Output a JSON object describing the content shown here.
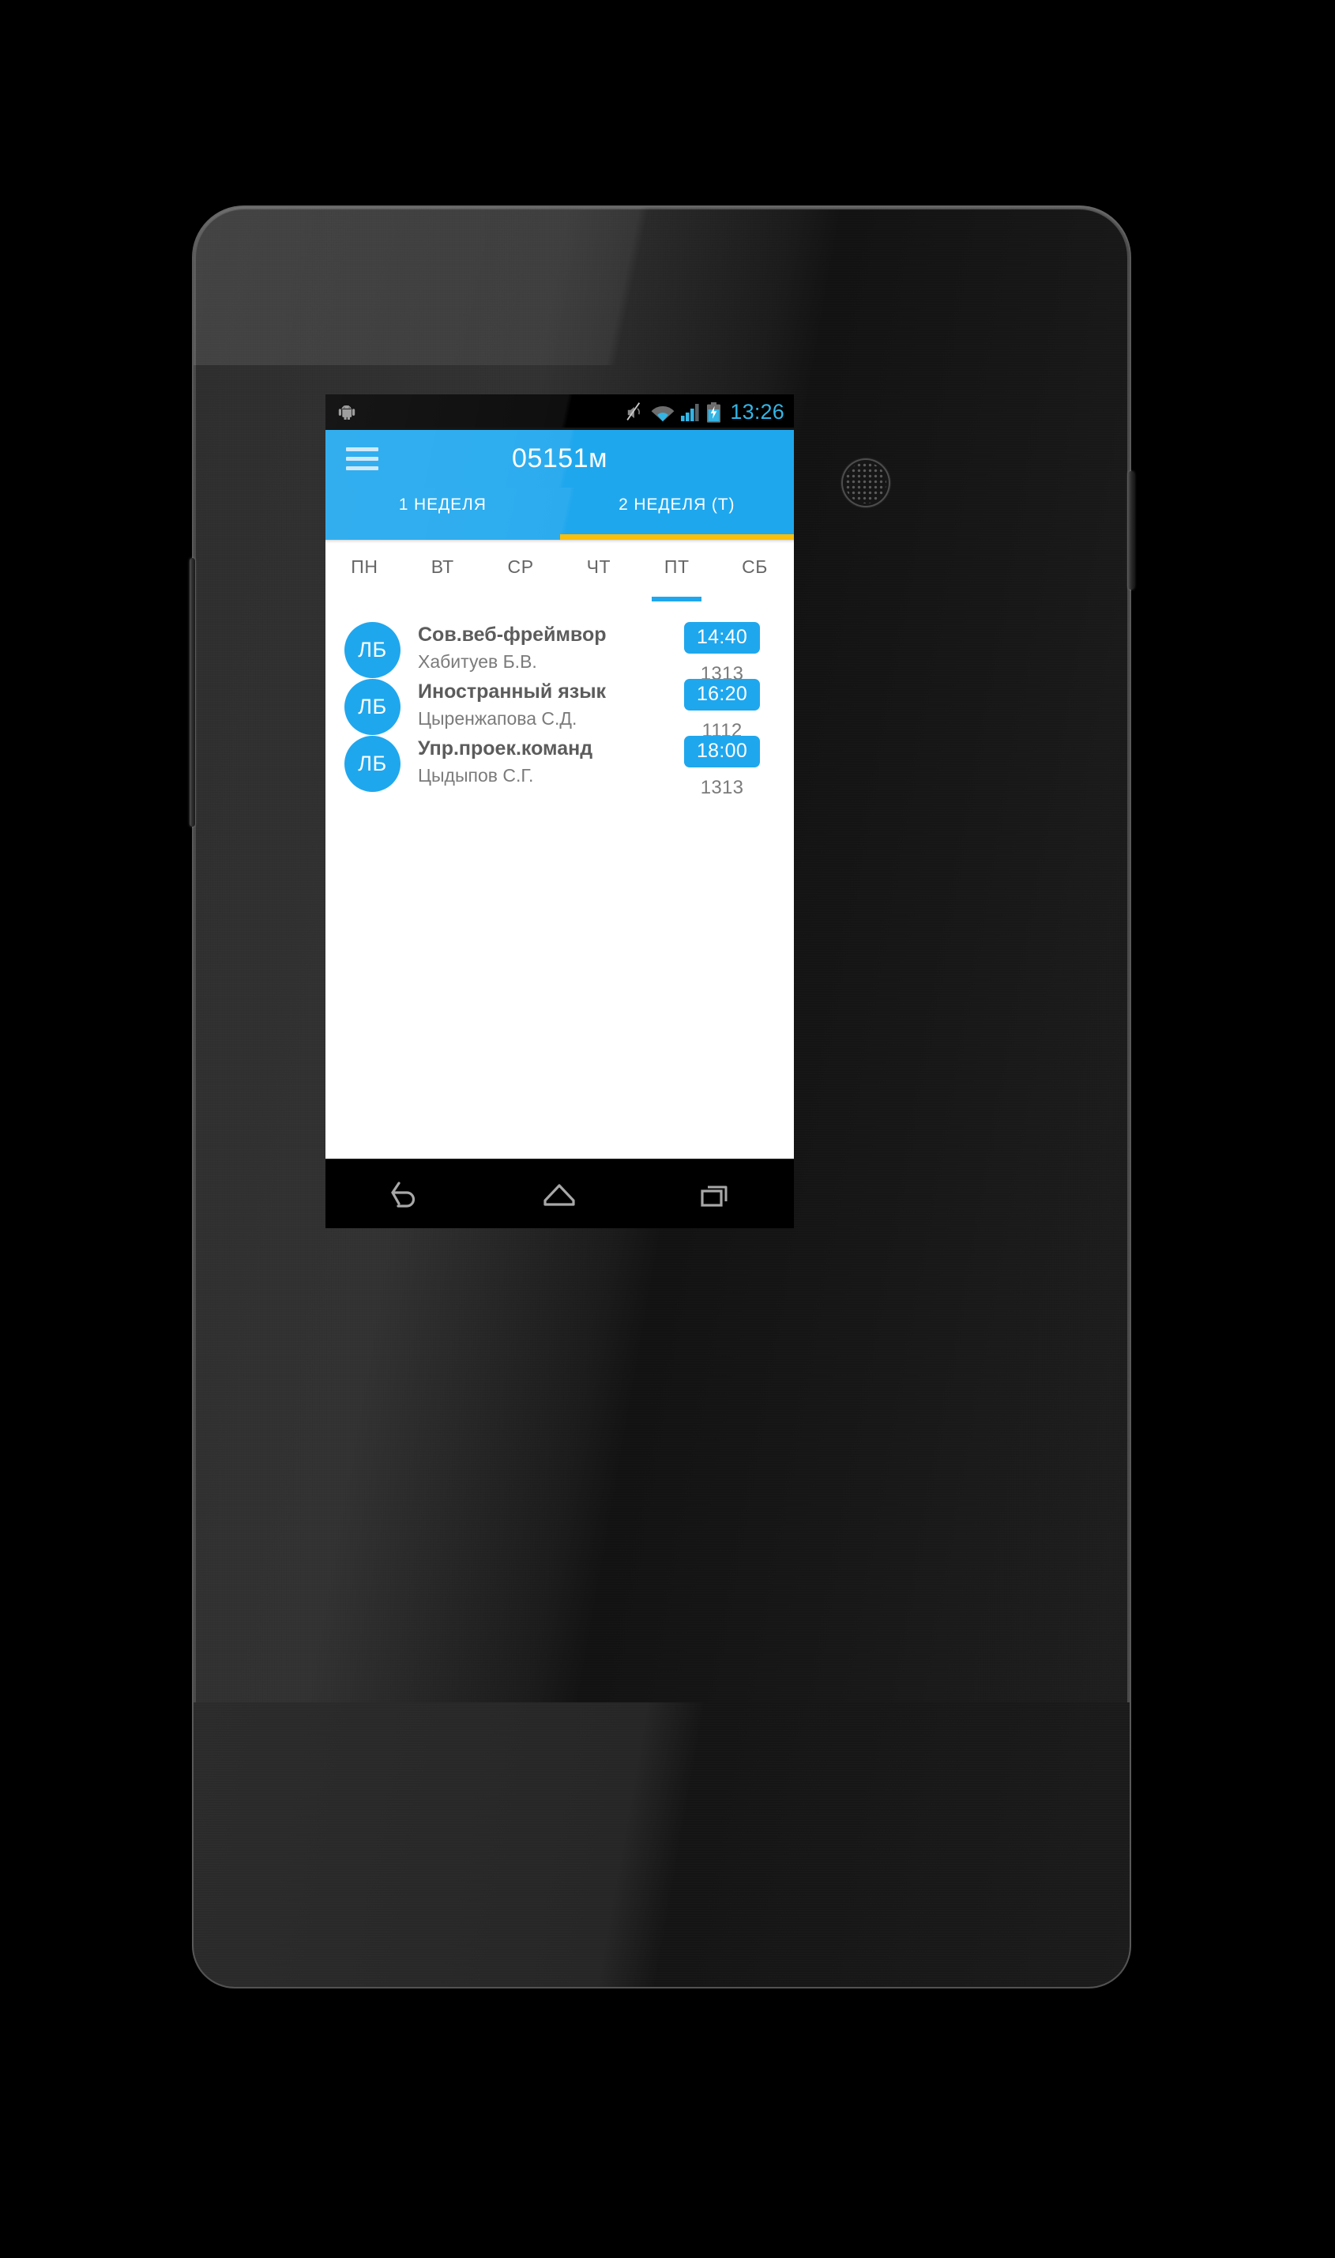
{
  "statusbar": {
    "time": "13:26",
    "icons": [
      "android-logo-icon",
      "volume-muted-icon",
      "wifi-icon",
      "signal-bars-icon",
      "battery-charging-icon"
    ]
  },
  "actionbar": {
    "menu_icon": "hamburger-menu-icon",
    "title": "05151м"
  },
  "week_tabs": [
    {
      "label": "1 НЕДЕЛЯ",
      "active": false
    },
    {
      "label": "2 НЕДЕЛЯ (Т)",
      "active": true
    }
  ],
  "days": [
    {
      "label": "ПН",
      "active": false
    },
    {
      "label": "ВТ",
      "active": false
    },
    {
      "label": "СР",
      "active": false
    },
    {
      "label": "ЧТ",
      "active": false
    },
    {
      "label": "ПТ",
      "active": true
    },
    {
      "label": "СБ",
      "active": false
    }
  ],
  "lessons": [
    {
      "badge": "ЛБ",
      "title": "Сов.веб-фреймвор",
      "teacher": "Хабитуев Б.В.",
      "time": "14:40",
      "room": "1313"
    },
    {
      "badge": "ЛБ",
      "title": "Иностранный язык",
      "teacher": "Цыренжапова С.Д.",
      "time": "16:20",
      "room": "1112"
    },
    {
      "badge": "ЛБ",
      "title": "Упр.проек.команд",
      "teacher": "Цыдыпов С.Г.",
      "time": "18:00",
      "room": "1313"
    }
  ],
  "navbar": [
    {
      "name": "back-button",
      "icon": "back-arrow-icon"
    },
    {
      "name": "home-button",
      "icon": "home-icon"
    },
    {
      "name": "recents-button",
      "icon": "recent-apps-icon"
    }
  ],
  "colors": {
    "accent_blue": "#1fa7ee",
    "tab_indicator_orange": "#fbbf09",
    "status_clock_blue": "#33b5e5",
    "title_gray": "#5c5c5c",
    "subtitle_gray": "#7b7b7b"
  }
}
